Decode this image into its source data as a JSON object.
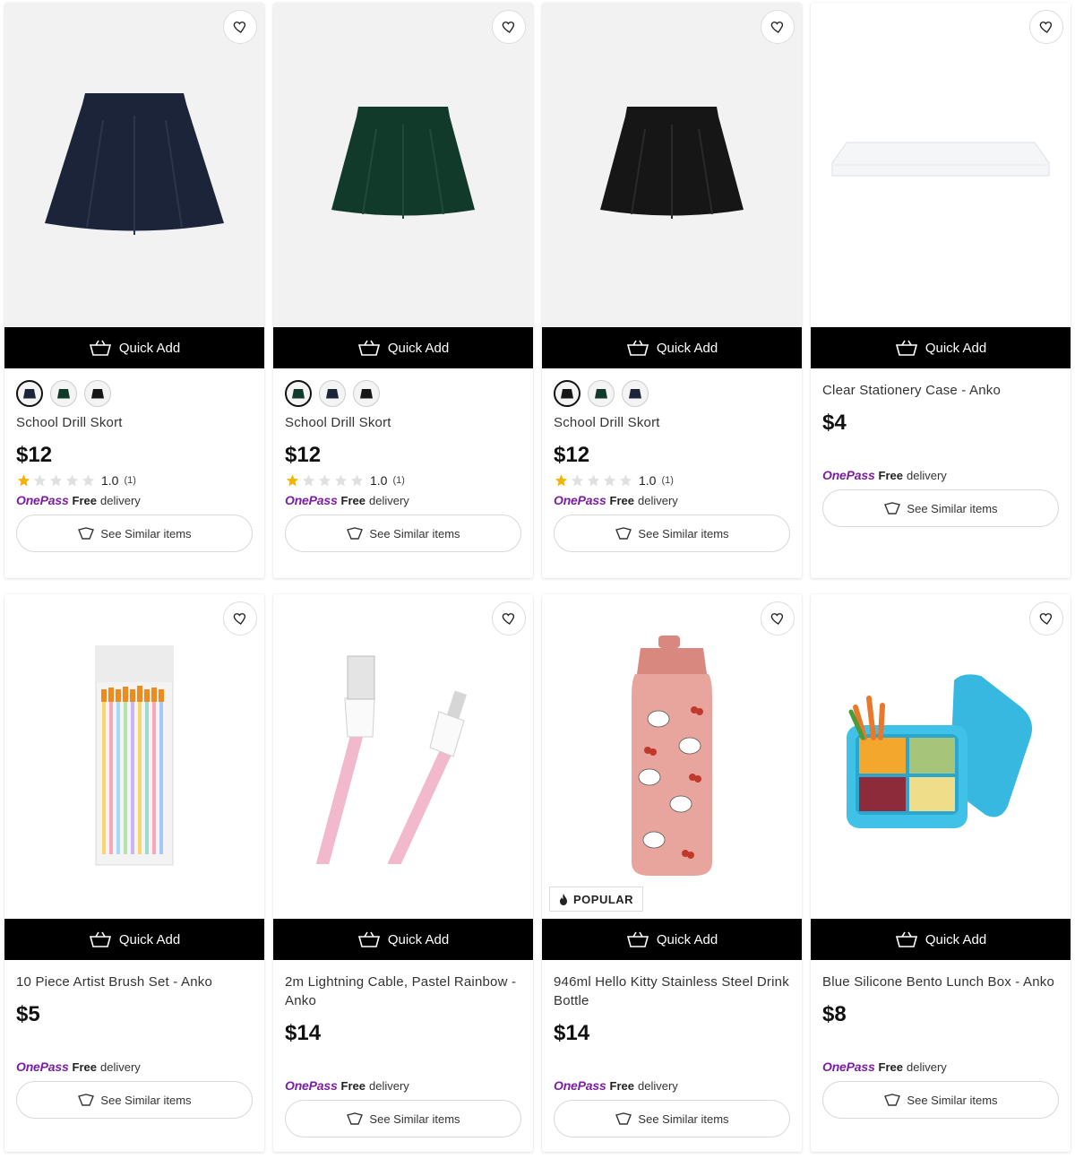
{
  "common": {
    "quick_add": "Quick Add",
    "see_similar": "See Similar items",
    "onepass_logo": "OnePass",
    "free": "Free",
    "delivery": "delivery",
    "popular": "POPULAR"
  },
  "products": [
    {
      "title": "School Drill Skort",
      "price": "$12",
      "rating": "1.0",
      "rating_count": "(1)",
      "rating_fraction": 0.2
    },
    {
      "title": "School Drill Skort",
      "price": "$12",
      "rating": "1.0",
      "rating_count": "(1)",
      "rating_fraction": 0.2
    },
    {
      "title": "School Drill Skort",
      "price": "$12",
      "rating": "1.0",
      "rating_count": "(1)",
      "rating_fraction": 0.2
    },
    {
      "title": "Clear Stationery Case - Anko",
      "price": "$4"
    },
    {
      "title": "10 Piece Artist Brush Set - Anko",
      "price": "$5"
    },
    {
      "title": "2m Lightning Cable, Pastel Rainbow - Anko",
      "price": "$14"
    },
    {
      "title": "946ml Hello Kitty Stainless Steel Drink Bottle",
      "price": "$14",
      "badge": "POPULAR"
    },
    {
      "title": "Blue Silicone Bento Lunch Box - Anko",
      "price": "$8"
    }
  ],
  "colors": {
    "navy": "#1b2438",
    "green": "#123a2a",
    "black": "#161616",
    "onepass_purple": "#7b1fa2",
    "star_gold": "#f5b400"
  },
  "icons": [
    "heart-icon",
    "basket-icon",
    "similar-icon",
    "star-icon",
    "flame-icon"
  ]
}
